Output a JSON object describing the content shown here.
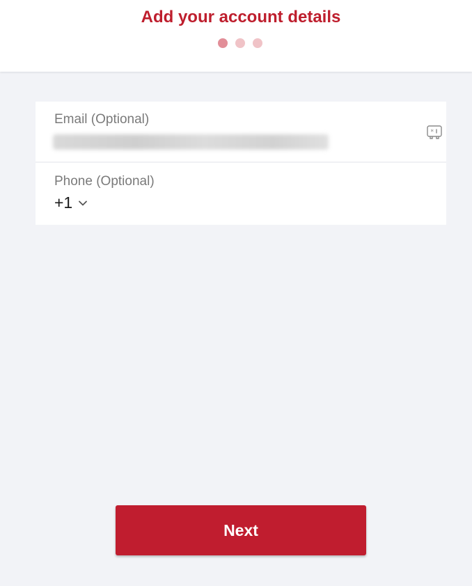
{
  "header": {
    "title": "Add your account details",
    "steps": [
      {
        "state": "active"
      },
      {
        "state": "inactive"
      },
      {
        "state": "inactive"
      }
    ]
  },
  "form": {
    "email": {
      "label": "Email (Optional)",
      "value_obscured": true
    },
    "phone": {
      "label": "Phone (Optional)",
      "country_code": "+1"
    }
  },
  "actions": {
    "next_label": "Next"
  },
  "icons": {
    "autofill": "keychain-autofill-icon",
    "country_dropdown": "chevron-down-icon"
  },
  "colors": {
    "brand_red": "#c01d2f",
    "title_red": "#be1e2d",
    "dot_active": "#e28e98",
    "dot_inactive": "#f0c3c7",
    "background": "#f2f3f7"
  }
}
